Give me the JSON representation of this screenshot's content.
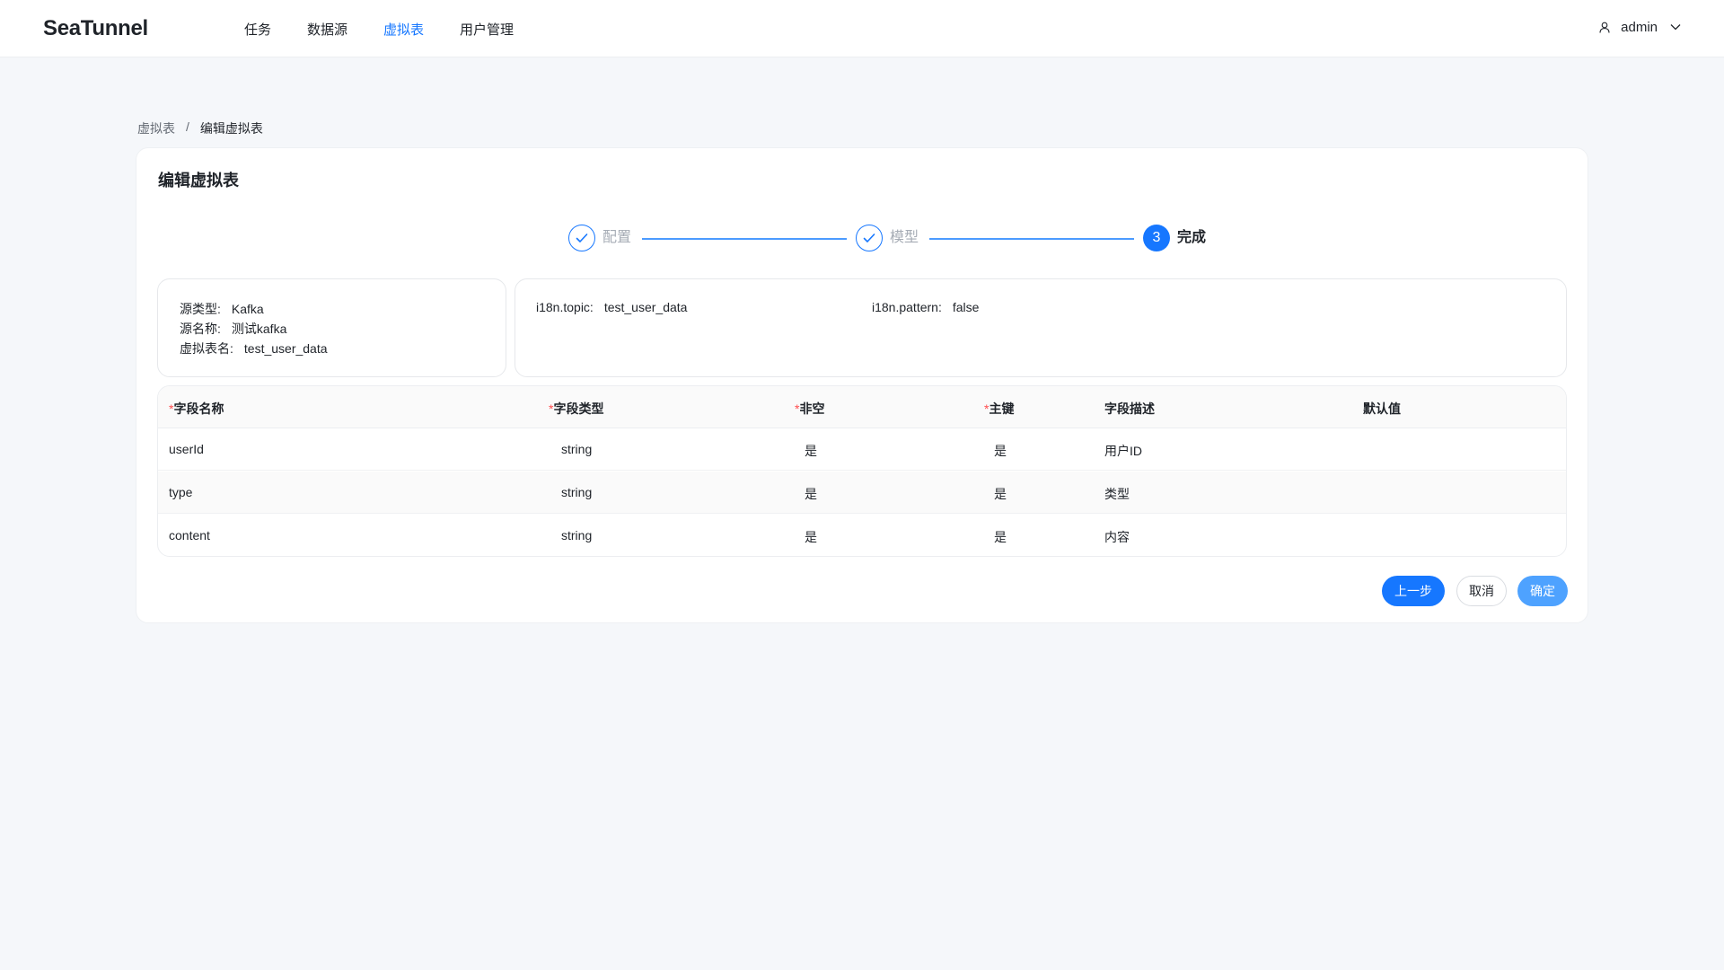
{
  "app": {
    "logo": "SeaTunnel"
  },
  "nav": {
    "items": [
      {
        "label": "任务"
      },
      {
        "label": "数据源"
      },
      {
        "label": "虚拟表"
      },
      {
        "label": "用户管理"
      }
    ],
    "active": "虚拟表"
  },
  "user": {
    "name": "admin",
    "icon": "user-icon",
    "dropdown_icon": "chevron-down-icon"
  },
  "breadcrumb": {
    "parent": "虚拟表",
    "separator": "/",
    "current": "编辑虚拟表"
  },
  "card": {
    "title": "编辑虚拟表"
  },
  "steps": [
    {
      "label": "配置",
      "status": "done",
      "icon": "check-icon"
    },
    {
      "label": "模型",
      "status": "done",
      "icon": "check-icon"
    },
    {
      "number": "3",
      "label": "完成",
      "status": "current"
    }
  ],
  "source_info": {
    "type_label": "源类型:",
    "type_value": "Kafka",
    "name_label": "源名称:",
    "name_value": "测试kafka",
    "table_label": "虚拟表名:",
    "table_value": "test_user_data"
  },
  "params": {
    "topic_label": "i18n.topic:",
    "topic_value": "test_user_data",
    "pattern_label": "i18n.pattern:",
    "pattern_value": "false"
  },
  "table": {
    "required_mark": "*",
    "headers": {
      "field_name": "字段名称",
      "field_type": "字段类型",
      "not_null": "非空",
      "primary_key": "主键",
      "description": "字段描述",
      "default_value": "默认值"
    },
    "rows": [
      {
        "field_name": "userId",
        "field_type": "string",
        "not_null": "是",
        "primary_key": "是",
        "description": "用户ID",
        "default_value": ""
      },
      {
        "field_name": "type",
        "field_type": "string",
        "not_null": "是",
        "primary_key": "是",
        "description": "类型",
        "default_value": ""
      },
      {
        "field_name": "content",
        "field_type": "string",
        "not_null": "是",
        "primary_key": "是",
        "description": "内容",
        "default_value": ""
      }
    ]
  },
  "buttons": {
    "prev": "上一步",
    "cancel": "取消",
    "confirm": "确定"
  },
  "colors": {
    "primary": "#1677ff",
    "required": "#ff4d4f",
    "background": "#f5f7fa"
  }
}
